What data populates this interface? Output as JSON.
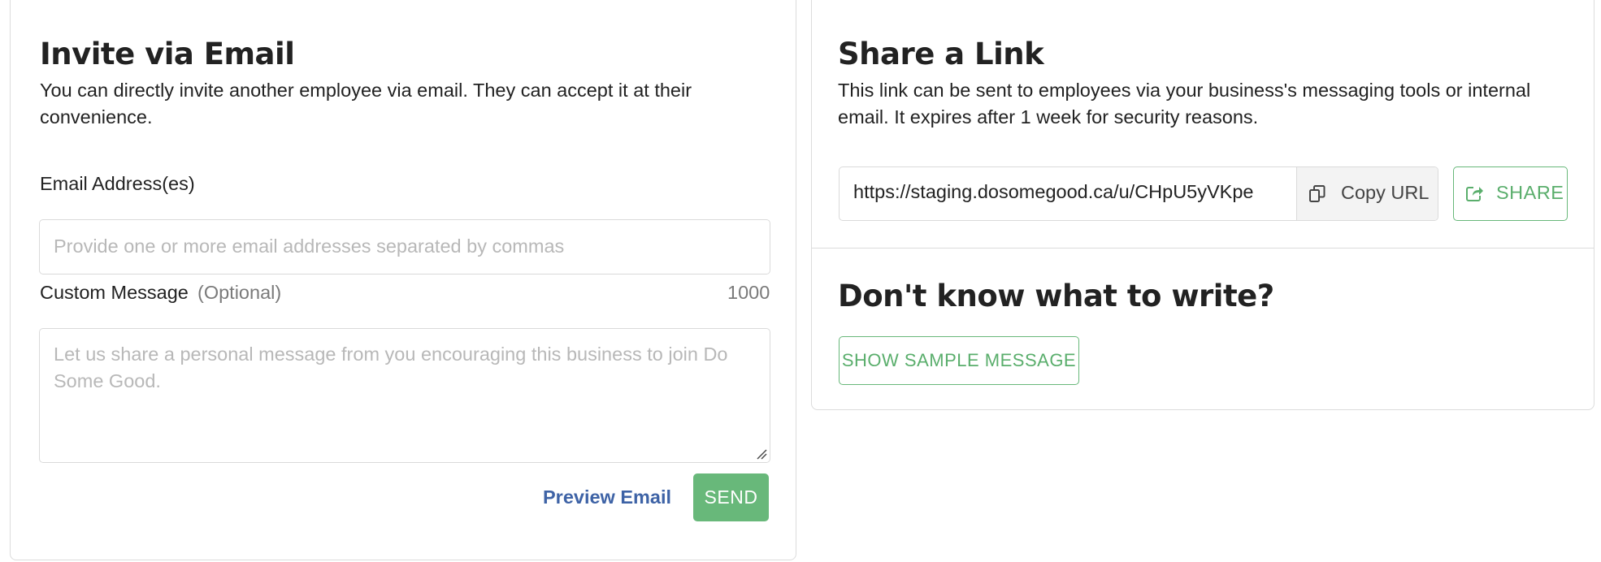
{
  "invite": {
    "title": "Invite via Email",
    "description": "You can directly invite another employee via email. They can accept it at their convenience.",
    "email_label": "Email Address(es)",
    "email_placeholder": "Provide one or more email addresses separated by commas",
    "email_value": "",
    "message_label": "Custom Message",
    "message_optional": "(Optional)",
    "message_char_count": "1000",
    "message_placeholder": "Let us share a personal message from you encouraging this business to join Do Some Good.",
    "message_value": "",
    "preview_label": "Preview Email",
    "send_label": "SEND"
  },
  "share": {
    "title": "Share a Link",
    "description": "This link can be sent to employees via your business's messaging tools or internal email. It expires after 1 week for security reasons.",
    "url": "https://staging.dosomegood.ca/u/CHpU5yVKpe",
    "copy_label": "Copy URL",
    "share_label": "SHARE",
    "help_title": "Don't know what to write?",
    "sample_label": "SHOW SAMPLE MESSAGE"
  },
  "icons": {
    "copy": "copy-icon",
    "share": "share-icon"
  },
  "colors": {
    "accent_green": "#68b87a",
    "link_blue": "#3e63a6",
    "border": "#dadada"
  }
}
